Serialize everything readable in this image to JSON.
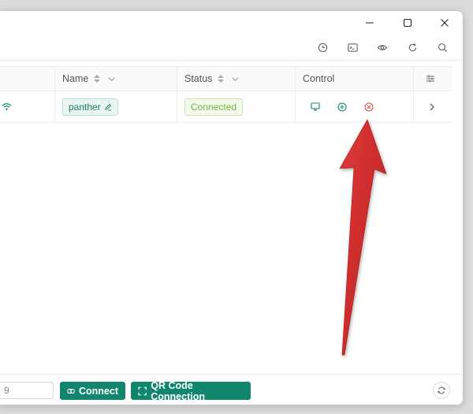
{
  "window": {
    "minimize_icon": "minimize-icon",
    "maximize_icon": "maximize-icon",
    "close_icon": "close-icon"
  },
  "toolbar": {
    "icons": [
      "history-icon",
      "terminal-icon",
      "eye-icon",
      "refresh-icon",
      "search-icon"
    ]
  },
  "table": {
    "columns": [
      {
        "label": "Name"
      },
      {
        "label": "Status"
      },
      {
        "label": "Control"
      }
    ],
    "rows": [
      {
        "connection_icon": "wifi-icon",
        "name": "panther",
        "status": "Connected",
        "controls": [
          "monitor-icon",
          "plus-circle-icon",
          "close-circle-icon"
        ]
      }
    ]
  },
  "footer": {
    "ip_value": "9",
    "connect_label": "Connect",
    "qr_label": "QR Code Connection"
  },
  "colors": {
    "accent": "#11866d",
    "tag_name_text": "#1f7a61",
    "status_text": "#6bb43a",
    "arrow": "#d42b2b"
  }
}
